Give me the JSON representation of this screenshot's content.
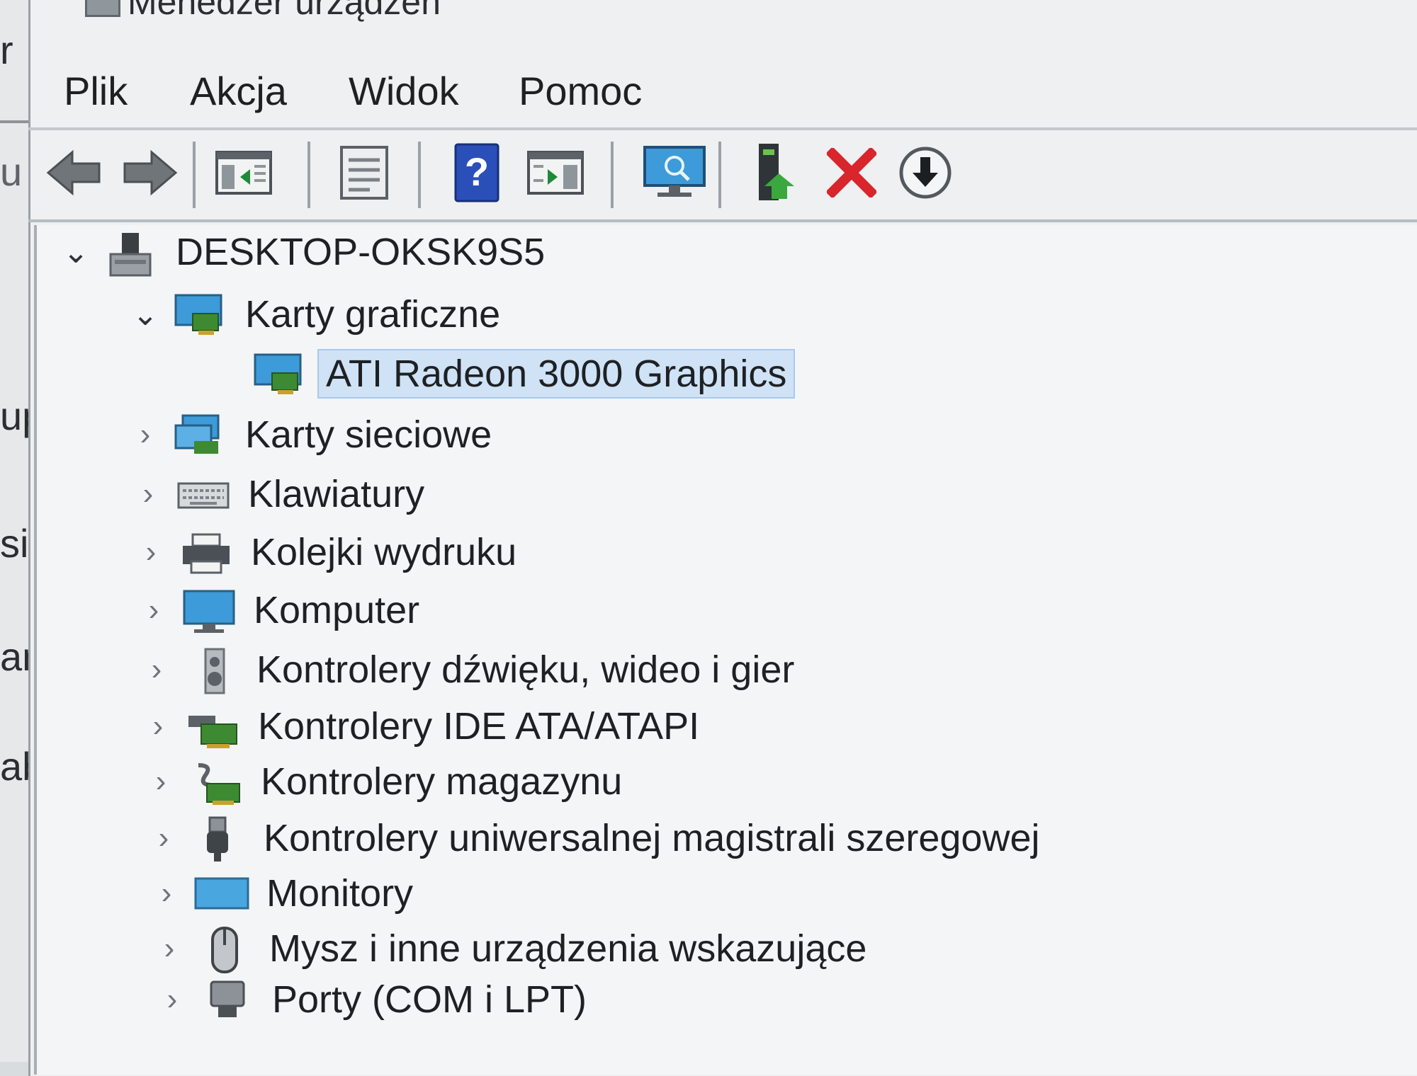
{
  "window": {
    "title": "Menedżer urządzeń"
  },
  "background_window": {
    "fragments": [
      "r",
      "u",
      "up",
      "sila",
      "ami",
      "able"
    ]
  },
  "menu": {
    "items": [
      "Plik",
      "Akcja",
      "Widok",
      "Pomoc"
    ]
  },
  "toolbar": {
    "buttons": [
      {
        "name": "back",
        "icon": "back-arrow-icon"
      },
      {
        "name": "forward",
        "icon": "forward-arrow-icon"
      },
      {
        "name": "show-hide-console-tree",
        "icon": "console-tree-icon"
      },
      {
        "name": "properties",
        "icon": "properties-icon"
      },
      {
        "name": "help",
        "icon": "help-icon"
      },
      {
        "name": "action-pane",
        "icon": "action-pane-icon"
      },
      {
        "name": "scan-hardware",
        "icon": "monitor-scan-icon"
      },
      {
        "name": "update-driver",
        "icon": "update-driver-icon"
      },
      {
        "name": "uninstall-device",
        "icon": "uninstall-x-icon"
      },
      {
        "name": "disable-device",
        "icon": "download-arrow-icon"
      }
    ]
  },
  "tree": {
    "root": {
      "label": "DESKTOP-OKSK9S5",
      "expanded": true,
      "icon": "computer-tower-icon"
    },
    "categories": [
      {
        "label": "Karty graficzne",
        "expanded": true,
        "icon": "display-adapter-icon",
        "children": [
          {
            "label": "ATI Radeon 3000 Graphics",
            "selected": true,
            "icon": "display-adapter-icon"
          }
        ]
      },
      {
        "label": "Karty sieciowe",
        "expanded": false,
        "icon": "network-adapter-icon"
      },
      {
        "label": "Klawiatury",
        "expanded": false,
        "icon": "keyboard-icon"
      },
      {
        "label": "Kolejki wydruku",
        "expanded": false,
        "icon": "printer-icon"
      },
      {
        "label": "Komputer",
        "expanded": false,
        "icon": "computer-icon"
      },
      {
        "label": "Kontrolery dźwięku, wideo i gier",
        "expanded": false,
        "icon": "speaker-icon"
      },
      {
        "label": "Kontrolery IDE ATA/ATAPI",
        "expanded": false,
        "icon": "ide-controller-icon"
      },
      {
        "label": "Kontrolery magazynu",
        "expanded": false,
        "icon": "storage-controller-icon"
      },
      {
        "label": "Kontrolery uniwersalnej magistrali szeregowej",
        "expanded": false,
        "icon": "usb-icon"
      },
      {
        "label": "Monitory",
        "expanded": false,
        "icon": "monitor-icon"
      },
      {
        "label": "Mysz i inne urządzenia wskazujące",
        "expanded": false,
        "icon": "mouse-icon"
      },
      {
        "label": "Porty (COM i LPT)",
        "expanded": false,
        "icon": "port-icon"
      }
    ]
  },
  "colors": {
    "selection": "#cfe2f6",
    "uninstall_red": "#d8262c",
    "help_blue": "#2a4fb8",
    "monitor_blue": "#3c9bd8"
  }
}
